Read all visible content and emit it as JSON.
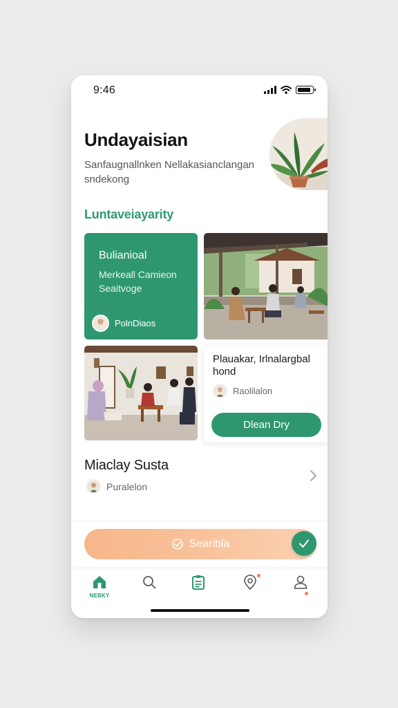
{
  "status_bar": {
    "time": "9:46"
  },
  "header": {
    "title": "Undayaisian",
    "subtitle": "Sanfaugnallnken Nellakasianclangan sndekong"
  },
  "section": {
    "title": "Luntaveiayarity"
  },
  "card_green": {
    "title": "Bulianioal",
    "subtitle": "Merkeall Camieon Seaitvoge",
    "person": "PolnDiaos"
  },
  "card_white": {
    "title": "Plauakar, Irlnalargbal hond",
    "person": "Raolilalon",
    "button": "Dlean Dry"
  },
  "list_item": {
    "title": "Miaclay Susta",
    "person": "Puralelon"
  },
  "cta": {
    "label": "Searibla"
  },
  "tabbar": {
    "tabs": [
      {
        "icon": "home-icon",
        "label": "NEBKY",
        "active": true
      },
      {
        "icon": "search-icon",
        "label": ""
      },
      {
        "icon": "clipboard-icon",
        "label": ""
      },
      {
        "icon": "location-pin-icon",
        "label": "",
        "badge": true
      },
      {
        "icon": "profile-icon",
        "label": "",
        "badge": true
      }
    ]
  },
  "colors": {
    "primary": "#2e9770",
    "accent_orange": "#f8b68a",
    "badge": "#f27a5e"
  }
}
